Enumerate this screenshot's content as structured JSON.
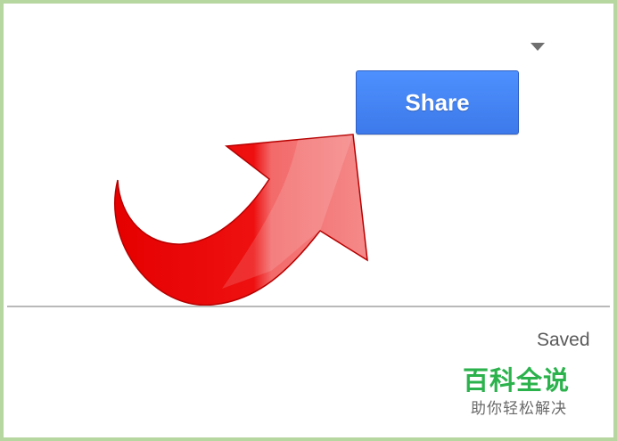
{
  "toolbar": {
    "share_label": "Share",
    "menu_icon": "chevron-down-icon"
  },
  "annotation": {
    "arrow_icon": "curved-arrow-icon",
    "arrow_color": "#e60000"
  },
  "status": {
    "saved_text": "Saved"
  },
  "watermark": {
    "title": "百科全说",
    "subtitle": "助你轻松解决",
    "color": "#2bb24c"
  },
  "colors": {
    "share_button": "#4d90fe",
    "frame_border": "#b7d7a1"
  }
}
